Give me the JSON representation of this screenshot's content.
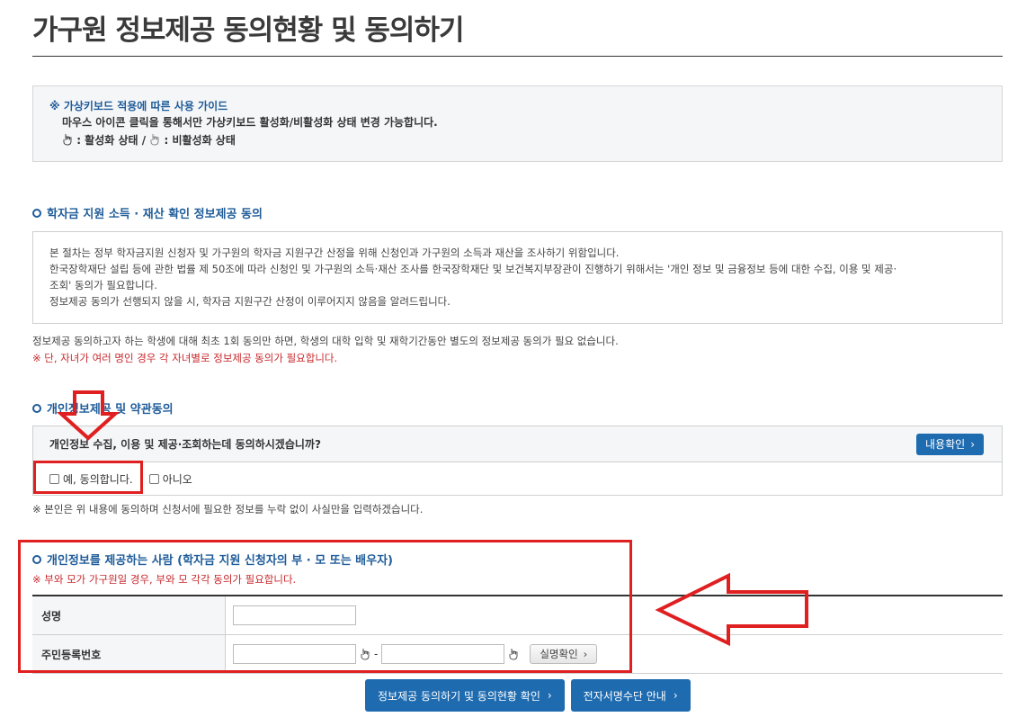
{
  "page": {
    "title": "가구원 정보제공 동의현황 및 동의하기"
  },
  "guide": {
    "title": "※ 가상키보드 적용에 따른 사용 가이드",
    "line1": "마우스 아이콘 클릭을 통해서만 가상키보드 활성화/비활성화 상태 변경 가능합니다.",
    "active_label": ": 활성화 상태 /",
    "inactive_label": ": 비활성화 상태"
  },
  "section1": {
    "heading": "학자금 지원 소득 · 재산 확인 정보제공 동의",
    "lines": [
      "본 절차는 정부 학자금지원 신청자 및 가구원의 학자금 지원구간 산정을 위해 신청인과 가구원의 소득과 재산을 조사하기 위함입니다.",
      "한국장학재단 설립 등에 관한 법률 제 50조에 따라 신청인 및 가구원의 소득·재산 조사를 한국장학재단 및 보건복지부장관이 진행하기 위해서는 '개인 정보 및 금융정보 등에 대한 수집, 이용 및 제공·",
      "조회' 동의가 필요합니다.",
      "정보제공 동의가 선행되지 않을 시, 학자금 지원구간 산정이 이루어지지 않음을 알려드립니다."
    ],
    "note": "정보제공 동의하고자 하는 학생에 대해 최초 1회 동의만 하면, 학생의 대학 입학 및 재학기간동안 별도의 정보제공 동의가 필요 없습니다.",
    "note_red": "※ 단, 자녀가 여러 명인 경우 각 자녀별로 정보제공 동의가 필요합니다."
  },
  "section2": {
    "heading": "개인정보제공 및 약관동의",
    "question": "개인정보 수집, 이용 및 제공·조회하는데 동의하시겠습니까?",
    "view_button": "내용확인",
    "option_yes": "예, 동의합니다.",
    "option_no": "아니오",
    "note": "※ 본인은 위 내용에 동의하며 신청서에 필요한 정보를 누락 없이 사실만을 입력하겠습니다."
  },
  "section3": {
    "heading": "개인정보를 제공하는 사람 (학자금 지원 신청자의 부 · 모 또는 배우자)",
    "note_red": "※ 부와 모가 가구원일 경우, 부와 모 각각 동의가 필요합니다.",
    "name_label": "성명",
    "name_value": "",
    "rrn_label": "주민등록번호",
    "rrn_front_value": "",
    "rrn_separator": "-",
    "rrn_back_value": "",
    "verify_button": "실명확인"
  },
  "buttons": {
    "consent_check": "정보제공 동의하기 및 동의현황 확인",
    "esign_guide": "전자서명수단 안내"
  },
  "colors": {
    "accent": "#1e6bb0",
    "heading": "#1f5c99",
    "warning": "#c8282d",
    "annotation": "#e02020"
  }
}
